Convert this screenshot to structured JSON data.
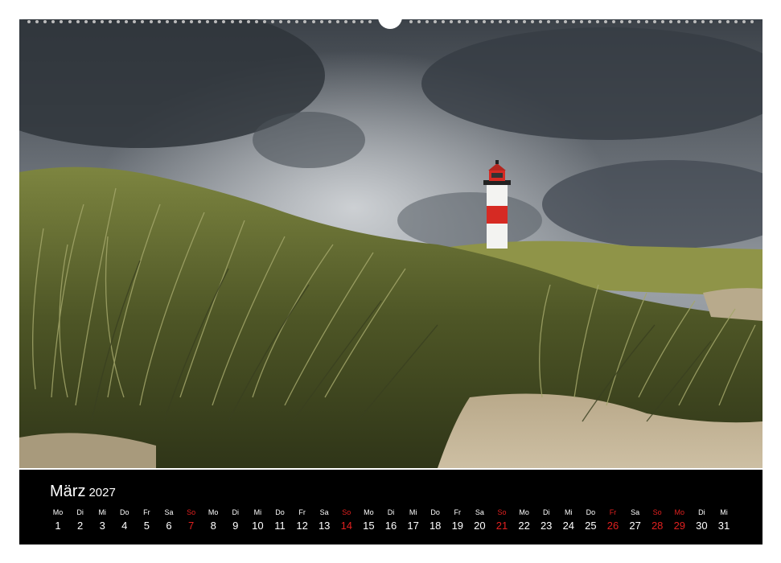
{
  "colors": {
    "sunday": "#e0201f",
    "holiday": "#e0201f",
    "weekday": "#ffffff",
    "calendar_bar": "#000000"
  },
  "photo": {
    "subject": "lighthouse-on-dunes-under-storm-clouds"
  },
  "calendar": {
    "month": "März",
    "year": "2027",
    "days": [
      {
        "wd": "Mo",
        "num": "1",
        "red": false
      },
      {
        "wd": "Di",
        "num": "2",
        "red": false
      },
      {
        "wd": "Mi",
        "num": "3",
        "red": false
      },
      {
        "wd": "Do",
        "num": "4",
        "red": false
      },
      {
        "wd": "Fr",
        "num": "5",
        "red": false
      },
      {
        "wd": "Sa",
        "num": "6",
        "red": false
      },
      {
        "wd": "So",
        "num": "7",
        "red": true
      },
      {
        "wd": "Mo",
        "num": "8",
        "red": false
      },
      {
        "wd": "Di",
        "num": "9",
        "red": false
      },
      {
        "wd": "Mi",
        "num": "10",
        "red": false
      },
      {
        "wd": "Do",
        "num": "11",
        "red": false
      },
      {
        "wd": "Fr",
        "num": "12",
        "red": false
      },
      {
        "wd": "Sa",
        "num": "13",
        "red": false
      },
      {
        "wd": "So",
        "num": "14",
        "red": true
      },
      {
        "wd": "Mo",
        "num": "15",
        "red": false
      },
      {
        "wd": "Di",
        "num": "16",
        "red": false
      },
      {
        "wd": "Mi",
        "num": "17",
        "red": false
      },
      {
        "wd": "Do",
        "num": "18",
        "red": false
      },
      {
        "wd": "Fr",
        "num": "19",
        "red": false
      },
      {
        "wd": "Sa",
        "num": "20",
        "red": false
      },
      {
        "wd": "So",
        "num": "21",
        "red": true
      },
      {
        "wd": "Mo",
        "num": "22",
        "red": false
      },
      {
        "wd": "Di",
        "num": "23",
        "red": false
      },
      {
        "wd": "Mi",
        "num": "24",
        "red": false
      },
      {
        "wd": "Do",
        "num": "25",
        "red": false
      },
      {
        "wd": "Fr",
        "num": "26",
        "red": true
      },
      {
        "wd": "Sa",
        "num": "27",
        "red": false
      },
      {
        "wd": "So",
        "num": "28",
        "red": true
      },
      {
        "wd": "Mo",
        "num": "29",
        "red": true
      },
      {
        "wd": "Di",
        "num": "30",
        "red": false
      },
      {
        "wd": "Mi",
        "num": "31",
        "red": false
      }
    ]
  }
}
